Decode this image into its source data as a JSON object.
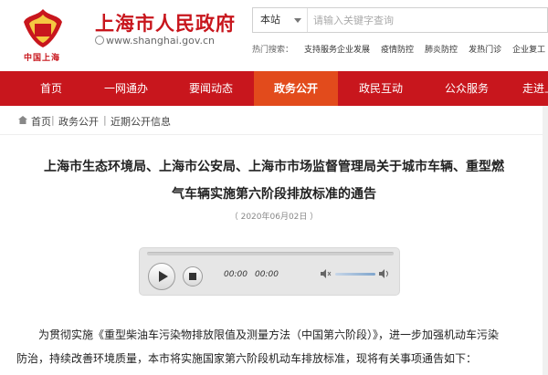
{
  "header": {
    "site_title": "上海市人民政府",
    "site_url": "www.shanghai.gov.cn",
    "logo_caption": "中国上海",
    "emblem_text": "申",
    "brand_color": "#c8161d"
  },
  "search": {
    "scope": "本站",
    "placeholder": "请输入关键字查询"
  },
  "hot": {
    "label": "热门搜索：",
    "items": [
      "支持服务企业发展",
      "疫情防控",
      "肺炎防控",
      "发热门诊",
      "企业复工"
    ]
  },
  "nav": {
    "items": [
      "首页",
      "一网通办",
      "要闻动态",
      "政务公开",
      "政民互动",
      "公众服务",
      "走进上海"
    ],
    "active_index": 3,
    "active_color": "#e24b1c"
  },
  "breadcrumb": {
    "items": [
      "首页",
      "政务公开",
      "近期公开信息"
    ],
    "separator": "|"
  },
  "article": {
    "title_line1": "上海市生态环境局、上海市公安局、上海市市场监督管理局关于城市车辆、重型燃",
    "title_line2": "气车辆实施第六阶段排放标准的通告",
    "date": "（ 2020年06月02日 ）",
    "para_line1": "为贯彻实施《重型柴油车污染物排放限值及测量方法（中国第六阶段）》，进一步加强机动车污染",
    "para_line2": "防治，持续改善环境质量，本市将实施国家第六阶段机动车排放标准，现将有关事项通告如下："
  },
  "player": {
    "current_time": "00:00",
    "duration": "00:00"
  }
}
